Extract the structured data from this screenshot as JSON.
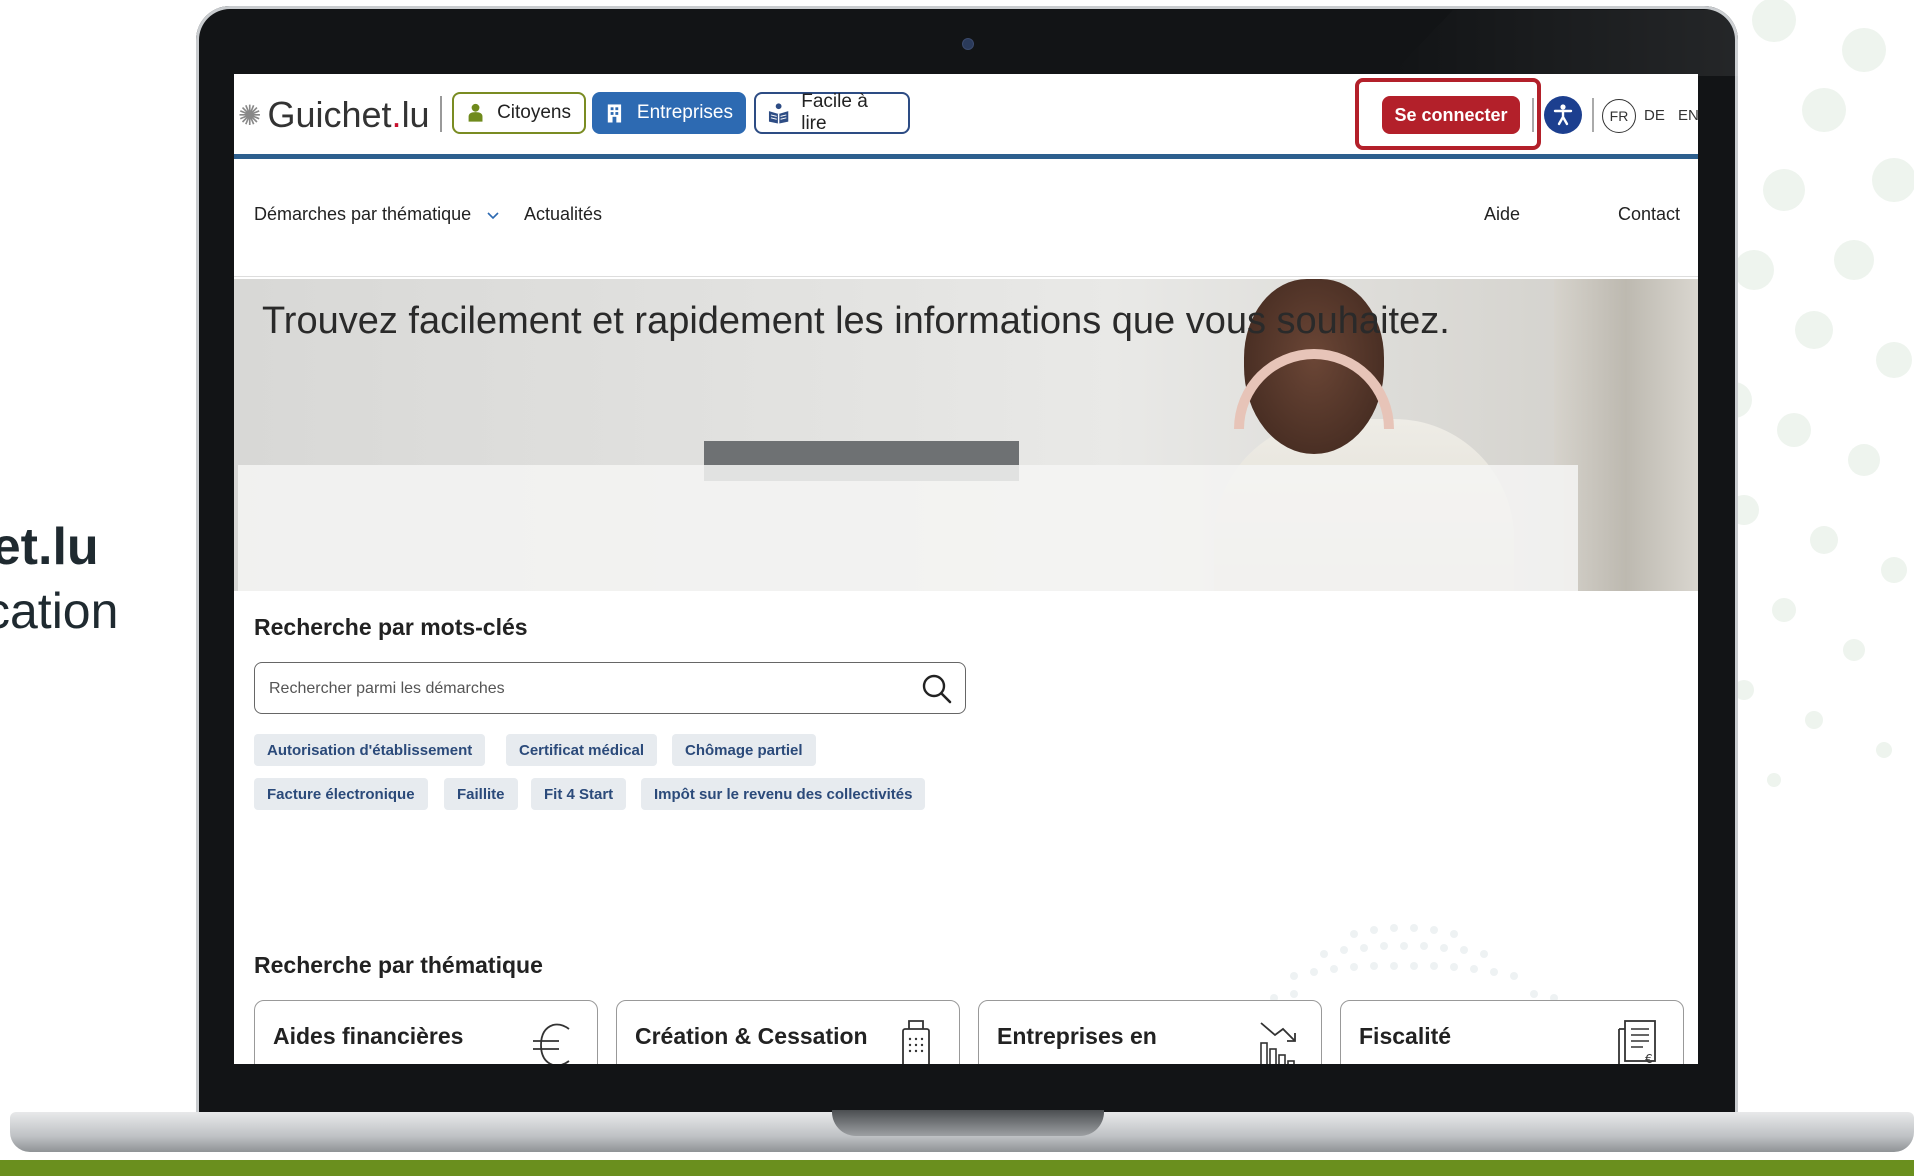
{
  "slide": {
    "line1": "het.lu",
    "line2": "fication"
  },
  "header": {
    "logo_text": "Guichet",
    "logo_dot": ".",
    "logo_tld": "lu",
    "tabs": [
      {
        "label": "Citoyens",
        "icon": "person-icon"
      },
      {
        "label": "Entreprises",
        "icon": "building-icon"
      },
      {
        "label": "Facile à lire",
        "icon": "easy-read-icon"
      }
    ],
    "connect_label": "Se connecter",
    "accessibility_icon": "accessibility-icon",
    "languages": [
      "FR",
      "DE",
      "EN"
    ],
    "active_language": "FR"
  },
  "nav": {
    "items": [
      {
        "label": "Démarches par thématique",
        "has_dropdown": true
      },
      {
        "label": "Actualités"
      }
    ],
    "right_items": [
      {
        "label": "Aide"
      },
      {
        "label": "Contact"
      }
    ]
  },
  "hero": {
    "title": "Trouvez facilement et rapidement les informations que vous souhaitez."
  },
  "search": {
    "heading": "Recherche par mots-clés",
    "placeholder": "Rechercher parmi les démarches",
    "tags_row1": [
      "Autorisation d'établissement",
      "Certificat médical",
      "Chômage partiel"
    ],
    "tags_row2": [
      "Facture électronique",
      "Faillite",
      "Fit 4 Start",
      "Impôt sur le revenu des collectivités"
    ]
  },
  "themes": {
    "heading": "Recherche par thématique",
    "cards": [
      {
        "title": "Aides financières",
        "icon": "euro-icon"
      },
      {
        "title": "Création & Cessation",
        "icon": "document-icon"
      },
      {
        "title": "Entreprises en",
        "icon": "chart-down-icon"
      },
      {
        "title": "Fiscalité",
        "icon": "invoice-icon"
      }
    ]
  },
  "colors": {
    "brand_blue": "#2d6ab2",
    "header_rule": "#2d5f8e",
    "connect_red": "#b3202a",
    "citoyens_green": "#7a8c22",
    "footer_green": "#6a8f1e"
  }
}
